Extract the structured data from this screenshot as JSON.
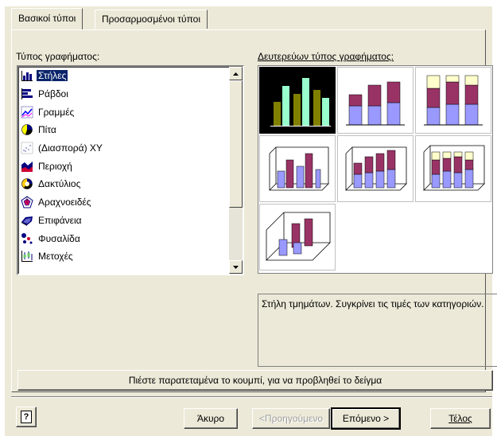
{
  "tabs": [
    {
      "label": "Βασικοί τύποι",
      "active": true
    },
    {
      "label": "Προσαρμοσμένοι τύποι",
      "active": false
    }
  ],
  "chart_type_label": "Τύπος γραφήματος:",
  "chart_types": [
    {
      "label": "Στήλες",
      "icon": "column-chart-icon",
      "selected": true
    },
    {
      "label": "Ράβδοι",
      "icon": "bar-chart-icon"
    },
    {
      "label": "Γραμμές",
      "icon": "line-chart-icon"
    },
    {
      "label": "Πίτα",
      "icon": "pie-chart-icon"
    },
    {
      "label": "(Διασπορά) XY",
      "icon": "scatter-chart-icon"
    },
    {
      "label": "Περιοχή",
      "icon": "area-chart-icon"
    },
    {
      "label": "Δακτύλιος",
      "icon": "doughnut-chart-icon"
    },
    {
      "label": "Αραχνοειδές",
      "icon": "radar-chart-icon"
    },
    {
      "label": "Επιφάνεια",
      "icon": "surface-chart-icon"
    },
    {
      "label": "Φυσαλίδα",
      "icon": "bubble-chart-icon"
    },
    {
      "label": "Μετοχές",
      "icon": "stock-chart-icon"
    }
  ],
  "subtype_label": "Δευτερεύων τύπος γραφήματος:",
  "subtypes": [
    {
      "name": "clustered-column",
      "selected": true
    },
    {
      "name": "stacked-column"
    },
    {
      "name": "100-percent-stacked-column"
    },
    {
      "name": "3d-clustered-column"
    },
    {
      "name": "3d-stacked-column"
    },
    {
      "name": "3d-100-percent-stacked-column"
    },
    {
      "name": "3d-column"
    }
  ],
  "description": "Στήλη τμημάτων. Συγκρίνει τις τιμές των κατηγοριών.",
  "preview_button": "Πιέστε παρατεταμένα το κουμπί, για να προβληθεί το δείγμα",
  "buttons": {
    "help": "?",
    "cancel": "Άκυρο",
    "back": "<Προηγούμενο",
    "next": "Επόμενο >",
    "finish": "Τέλος"
  },
  "colors": {
    "dialog_bg": "#ece9d8",
    "selection": "#0a246a",
    "series1": "#9999ff",
    "series2": "#993366",
    "series3": "#ffffcc",
    "selected_series": "#99ffcc",
    "selected_series2": "#808000"
  }
}
